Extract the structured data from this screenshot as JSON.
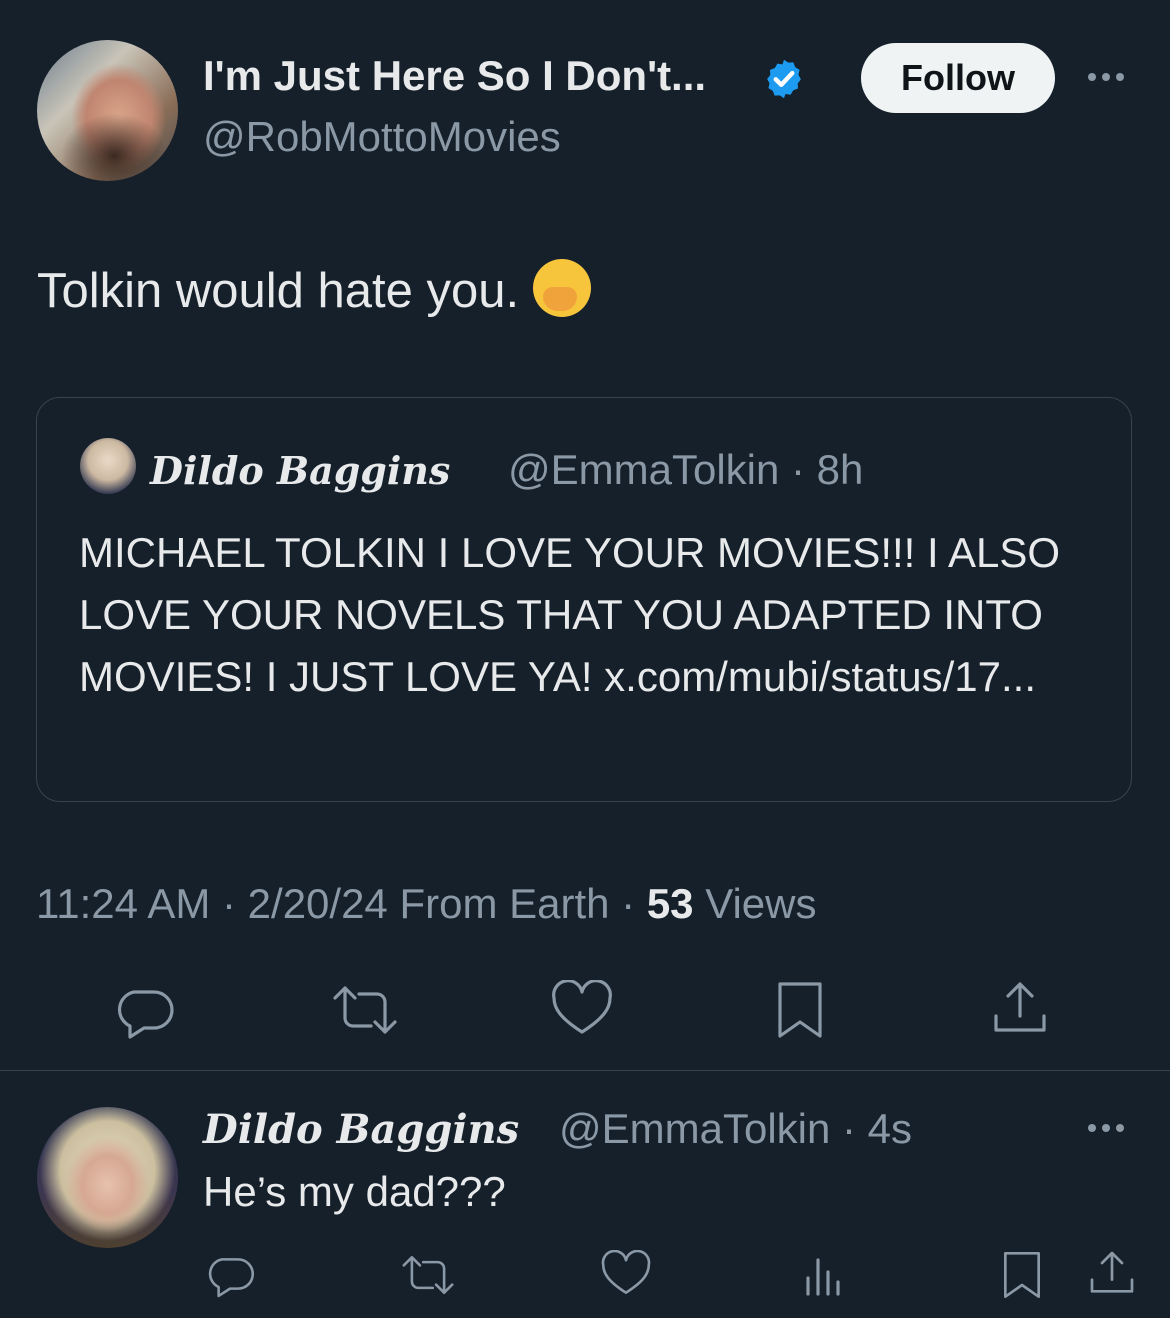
{
  "tweet": {
    "author_name": "I'm Just Here So I Don't...",
    "author_handle": "@RobMottoMovies",
    "follow_label": "Follow",
    "text": "Tolkin would hate you.",
    "emoji": "hand-over-mouth-emoji",
    "timestamp": "11:24 AM · 2/20/24 From Earth · ",
    "views_count": "53",
    "views_label": " Views"
  },
  "quote": {
    "author_name": "Dildo Baggins",
    "meta": "@EmmaTolkin · 8h",
    "text": "MICHAEL TOLKIN I LOVE YOUR MOVIES!!! I ALSO LOVE YOUR NOVELS THAT YOU ADAPTED INTO MOVIES! I JUST LOVE YA! x.com/mubi/status/17..."
  },
  "reply": {
    "author_name": "Dildo Baggins",
    "meta": "@EmmaTolkin · 4s",
    "text": "He’s my dad???"
  },
  "colors": {
    "background": "#15202b",
    "text": "#e7e9ea",
    "muted": "#8b98a5",
    "verified": "#1d9bf0"
  },
  "icons": {
    "actions": [
      "reply-icon",
      "retweet-icon",
      "like-icon",
      "bookmark-icon",
      "share-icon"
    ],
    "reply_actions": [
      "reply-icon",
      "retweet-icon",
      "like-icon",
      "views-icon",
      "bookmark-icon",
      "share-icon"
    ]
  }
}
